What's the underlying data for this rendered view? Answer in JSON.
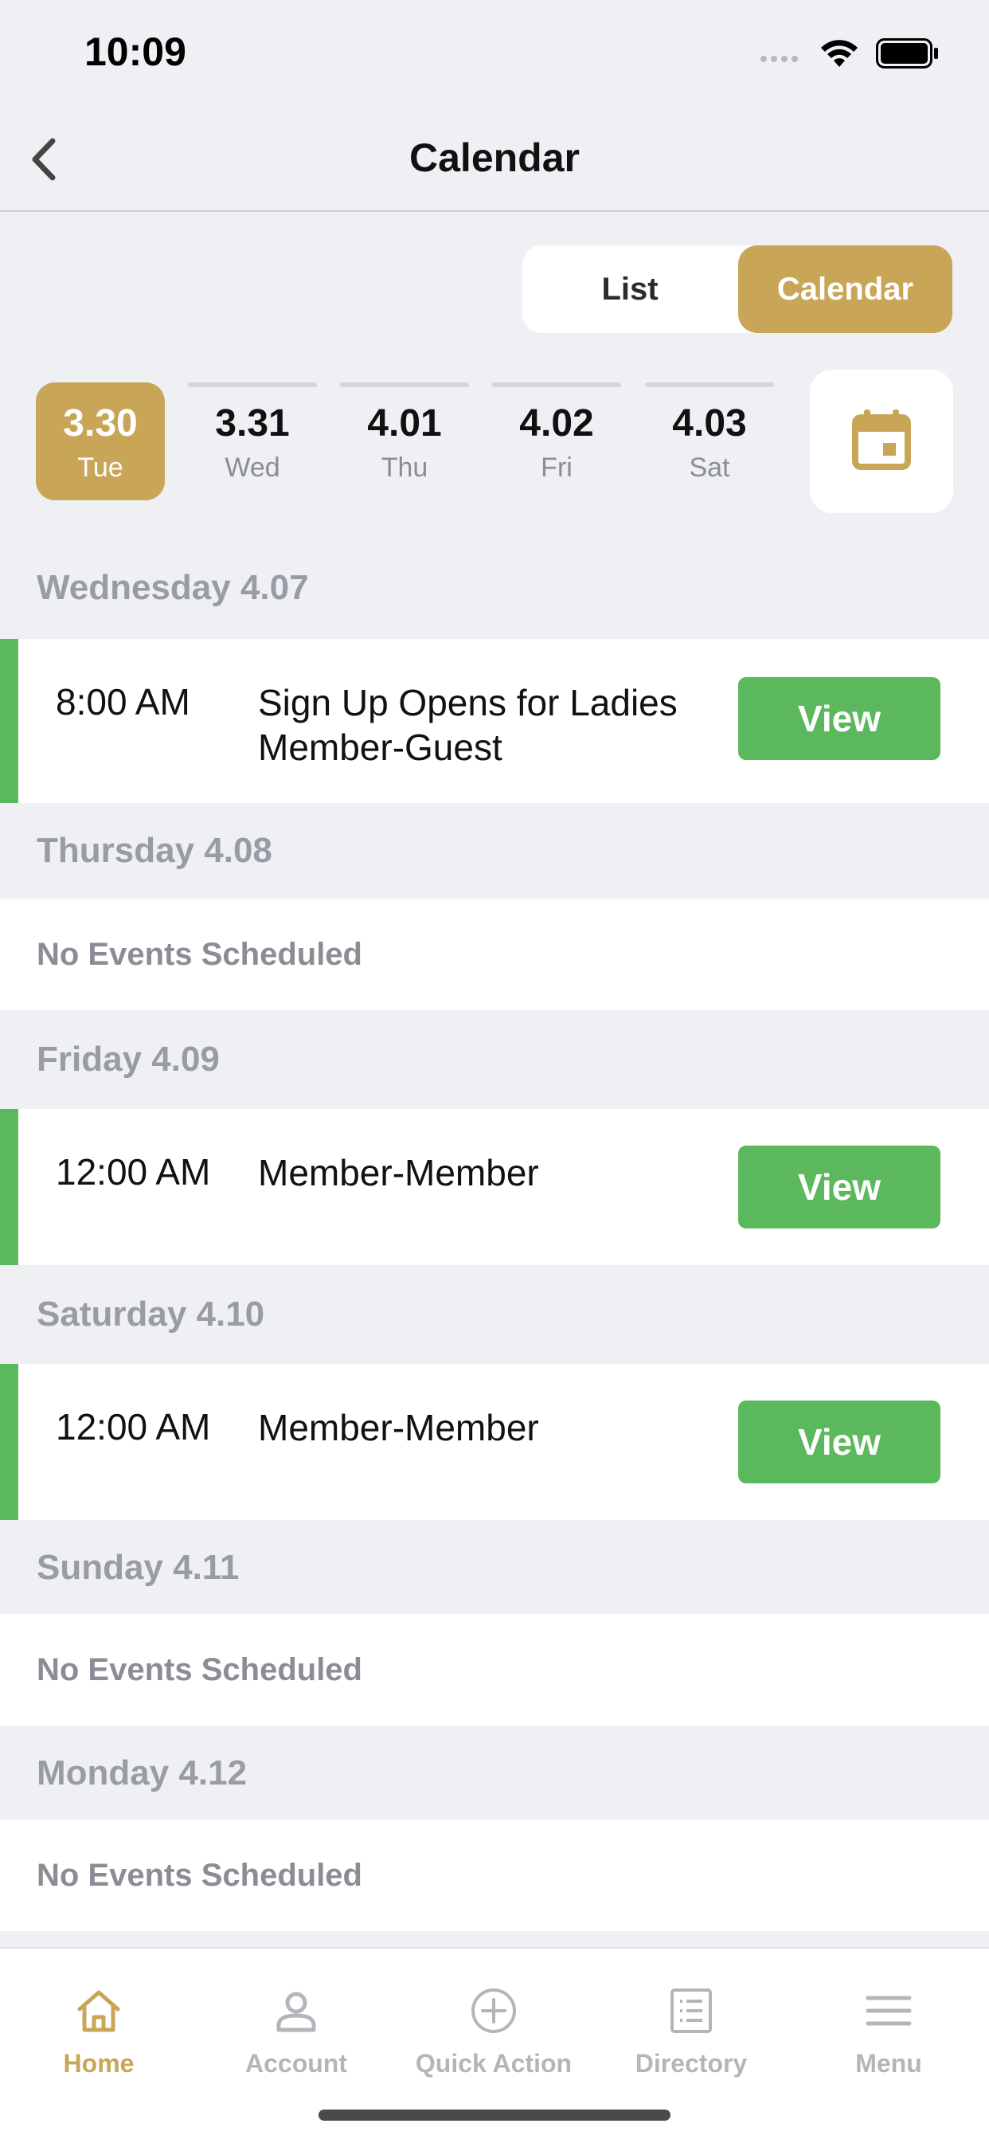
{
  "status_bar": {
    "time": "10:09"
  },
  "nav": {
    "title": "Calendar",
    "back_icon": "chevron-left-icon"
  },
  "view_toggle": {
    "list_label": "List",
    "calendar_label": "Calendar",
    "selected": "Calendar"
  },
  "date_strip": {
    "dates": [
      {
        "num": "3.30",
        "dow": "Tue",
        "selected": true
      },
      {
        "num": "3.31",
        "dow": "Wed"
      },
      {
        "num": "4.01",
        "dow": "Thu"
      },
      {
        "num": "4.02",
        "dow": "Fri"
      },
      {
        "num": "4.03",
        "dow": "Sat"
      }
    ],
    "picker_icon": "calendar-icon"
  },
  "days": [
    {
      "header": "Wednesday 4.07",
      "events": [
        {
          "time": "8:00 AM",
          "title": "Sign Up Opens for Ladies Member-Guest",
          "button": "View"
        }
      ]
    },
    {
      "header": "Thursday 4.08",
      "empty_text": "No Events Scheduled"
    },
    {
      "header": "Friday 4.09",
      "events": [
        {
          "time": "12:00 AM",
          "title": "Member-Member",
          "button": "View"
        }
      ]
    },
    {
      "header": "Saturday 4.10",
      "events": [
        {
          "time": "12:00 AM",
          "title": "Member-Member",
          "button": "View"
        }
      ]
    },
    {
      "header": "Sunday 4.11",
      "empty_text": "No Events Scheduled"
    },
    {
      "header": "Monday 4.12",
      "empty_text": "No Events Scheduled"
    }
  ],
  "tab_bar": {
    "items": [
      {
        "label": "Home",
        "icon": "home-icon",
        "active": true
      },
      {
        "label": "Account",
        "icon": "person-icon"
      },
      {
        "label": "Quick Action",
        "icon": "plus-circle-icon"
      },
      {
        "label": "Directory",
        "icon": "list-document-icon"
      },
      {
        "label": "Menu",
        "icon": "hamburger-menu-icon"
      }
    ]
  },
  "colors": {
    "accent_gold": "#c9a558",
    "event_green": "#5cb85c",
    "background": "#eff0f4"
  }
}
